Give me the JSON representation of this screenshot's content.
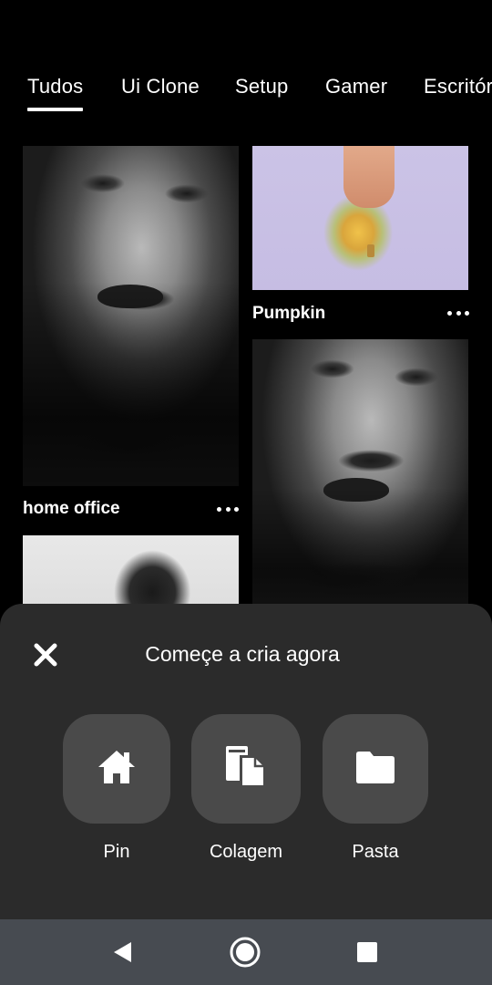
{
  "tabs": [
    {
      "label": "Tudos",
      "active": true
    },
    {
      "label": "Ui Clone",
      "active": false
    },
    {
      "label": "Setup",
      "active": false
    },
    {
      "label": "Gamer",
      "active": false
    },
    {
      "label": "Escritório",
      "active": false
    }
  ],
  "pins": {
    "left": [
      {
        "title": "home office",
        "image": "black-and-white-portrait"
      },
      {
        "title": "",
        "image": "portrait-light-background"
      }
    ],
    "right": [
      {
        "title": "Pumpkin",
        "image": "hand-on-melon"
      },
      {
        "title": "",
        "image": "black-and-white-portrait"
      }
    ],
    "more_icon": "more-horizontal-icon"
  },
  "sheet": {
    "title": "Começe a cria agora",
    "close_icon": "close-icon",
    "actions": [
      {
        "label": "Pin",
        "icon": "home-icon"
      },
      {
        "label": "Colagem",
        "icon": "collage-icon"
      },
      {
        "label": "Pasta",
        "icon": "folder-icon"
      }
    ]
  },
  "navbar": {
    "buttons": [
      "back-icon",
      "home-circle-icon",
      "recents-square-icon"
    ]
  },
  "colors": {
    "background": "#000000",
    "sheet": "#2b2b2b",
    "tile": "#4a4a4a",
    "navbar": "#474b51",
    "text": "#ffffff"
  }
}
